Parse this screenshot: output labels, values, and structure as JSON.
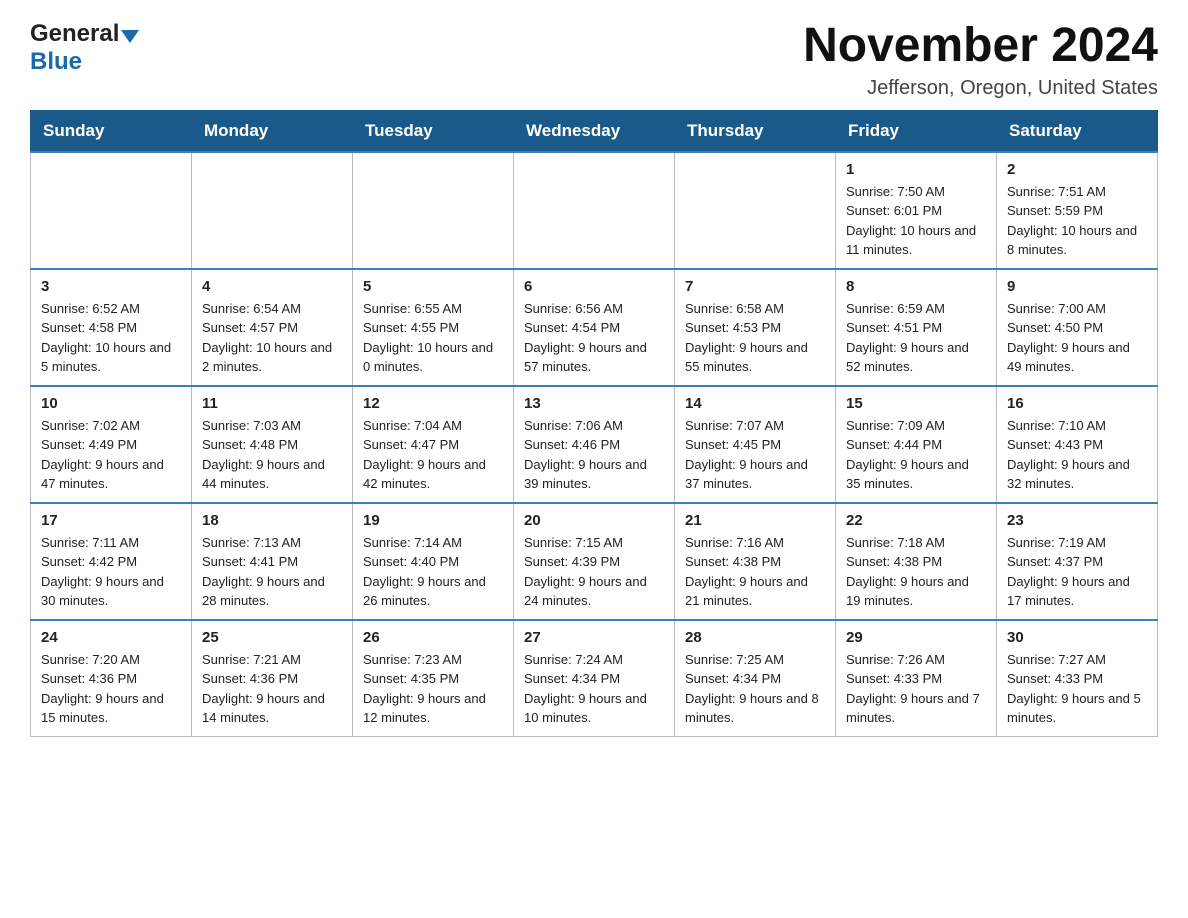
{
  "header": {
    "logo_general": "General",
    "logo_arrow": "▼",
    "logo_blue": "Blue",
    "title": "November 2024",
    "subtitle": "Jefferson, Oregon, United States"
  },
  "days_of_week": [
    "Sunday",
    "Monday",
    "Tuesday",
    "Wednesday",
    "Thursday",
    "Friday",
    "Saturday"
  ],
  "weeks": [
    {
      "days": [
        {
          "num": "",
          "info": ""
        },
        {
          "num": "",
          "info": ""
        },
        {
          "num": "",
          "info": ""
        },
        {
          "num": "",
          "info": ""
        },
        {
          "num": "",
          "info": ""
        },
        {
          "num": "1",
          "info": "Sunrise: 7:50 AM\nSunset: 6:01 PM\nDaylight: 10 hours and 11 minutes."
        },
        {
          "num": "2",
          "info": "Sunrise: 7:51 AM\nSunset: 5:59 PM\nDaylight: 10 hours and 8 minutes."
        }
      ]
    },
    {
      "days": [
        {
          "num": "3",
          "info": "Sunrise: 6:52 AM\nSunset: 4:58 PM\nDaylight: 10 hours and 5 minutes."
        },
        {
          "num": "4",
          "info": "Sunrise: 6:54 AM\nSunset: 4:57 PM\nDaylight: 10 hours and 2 minutes."
        },
        {
          "num": "5",
          "info": "Sunrise: 6:55 AM\nSunset: 4:55 PM\nDaylight: 10 hours and 0 minutes."
        },
        {
          "num": "6",
          "info": "Sunrise: 6:56 AM\nSunset: 4:54 PM\nDaylight: 9 hours and 57 minutes."
        },
        {
          "num": "7",
          "info": "Sunrise: 6:58 AM\nSunset: 4:53 PM\nDaylight: 9 hours and 55 minutes."
        },
        {
          "num": "8",
          "info": "Sunrise: 6:59 AM\nSunset: 4:51 PM\nDaylight: 9 hours and 52 minutes."
        },
        {
          "num": "9",
          "info": "Sunrise: 7:00 AM\nSunset: 4:50 PM\nDaylight: 9 hours and 49 minutes."
        }
      ]
    },
    {
      "days": [
        {
          "num": "10",
          "info": "Sunrise: 7:02 AM\nSunset: 4:49 PM\nDaylight: 9 hours and 47 minutes."
        },
        {
          "num": "11",
          "info": "Sunrise: 7:03 AM\nSunset: 4:48 PM\nDaylight: 9 hours and 44 minutes."
        },
        {
          "num": "12",
          "info": "Sunrise: 7:04 AM\nSunset: 4:47 PM\nDaylight: 9 hours and 42 minutes."
        },
        {
          "num": "13",
          "info": "Sunrise: 7:06 AM\nSunset: 4:46 PM\nDaylight: 9 hours and 39 minutes."
        },
        {
          "num": "14",
          "info": "Sunrise: 7:07 AM\nSunset: 4:45 PM\nDaylight: 9 hours and 37 minutes."
        },
        {
          "num": "15",
          "info": "Sunrise: 7:09 AM\nSunset: 4:44 PM\nDaylight: 9 hours and 35 minutes."
        },
        {
          "num": "16",
          "info": "Sunrise: 7:10 AM\nSunset: 4:43 PM\nDaylight: 9 hours and 32 minutes."
        }
      ]
    },
    {
      "days": [
        {
          "num": "17",
          "info": "Sunrise: 7:11 AM\nSunset: 4:42 PM\nDaylight: 9 hours and 30 minutes."
        },
        {
          "num": "18",
          "info": "Sunrise: 7:13 AM\nSunset: 4:41 PM\nDaylight: 9 hours and 28 minutes."
        },
        {
          "num": "19",
          "info": "Sunrise: 7:14 AM\nSunset: 4:40 PM\nDaylight: 9 hours and 26 minutes."
        },
        {
          "num": "20",
          "info": "Sunrise: 7:15 AM\nSunset: 4:39 PM\nDaylight: 9 hours and 24 minutes."
        },
        {
          "num": "21",
          "info": "Sunrise: 7:16 AM\nSunset: 4:38 PM\nDaylight: 9 hours and 21 minutes."
        },
        {
          "num": "22",
          "info": "Sunrise: 7:18 AM\nSunset: 4:38 PM\nDaylight: 9 hours and 19 minutes."
        },
        {
          "num": "23",
          "info": "Sunrise: 7:19 AM\nSunset: 4:37 PM\nDaylight: 9 hours and 17 minutes."
        }
      ]
    },
    {
      "days": [
        {
          "num": "24",
          "info": "Sunrise: 7:20 AM\nSunset: 4:36 PM\nDaylight: 9 hours and 15 minutes."
        },
        {
          "num": "25",
          "info": "Sunrise: 7:21 AM\nSunset: 4:36 PM\nDaylight: 9 hours and 14 minutes."
        },
        {
          "num": "26",
          "info": "Sunrise: 7:23 AM\nSunset: 4:35 PM\nDaylight: 9 hours and 12 minutes."
        },
        {
          "num": "27",
          "info": "Sunrise: 7:24 AM\nSunset: 4:34 PM\nDaylight: 9 hours and 10 minutes."
        },
        {
          "num": "28",
          "info": "Sunrise: 7:25 AM\nSunset: 4:34 PM\nDaylight: 9 hours and 8 minutes."
        },
        {
          "num": "29",
          "info": "Sunrise: 7:26 AM\nSunset: 4:33 PM\nDaylight: 9 hours and 7 minutes."
        },
        {
          "num": "30",
          "info": "Sunrise: 7:27 AM\nSunset: 4:33 PM\nDaylight: 9 hours and 5 minutes."
        }
      ]
    }
  ]
}
